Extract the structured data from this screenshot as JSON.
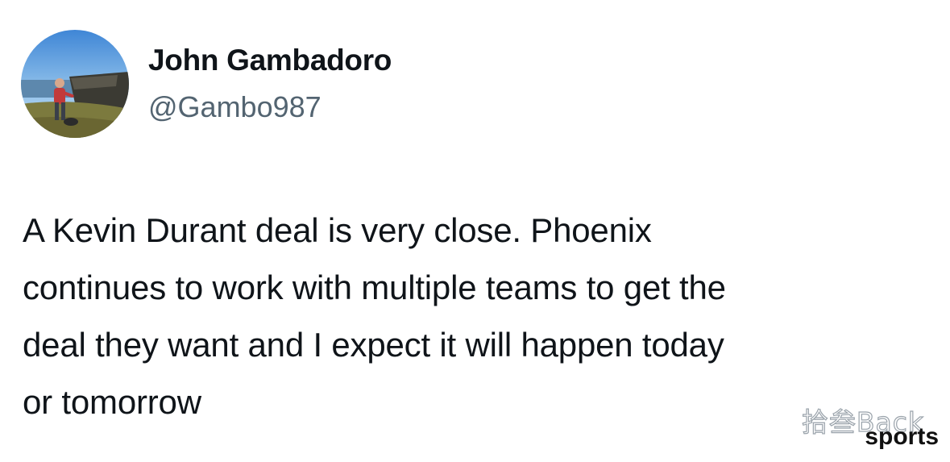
{
  "tweet": {
    "author_name": "John Gambadoro",
    "author_handle": "@Gambo987",
    "avatar": "profile-photo",
    "text_lines": [
      "A Kevin Durant deal is very close. Phoenix",
      "continues to work with multiple teams to get the",
      "deal they want and I expect it will happen today",
      "or tomorrow"
    ]
  },
  "watermark": {
    "script": "拾叁Back",
    "label": "sports"
  },
  "colors": {
    "name": "#0f1419",
    "handle": "#536471",
    "text": "#0f1419",
    "background": "#ffffff"
  }
}
